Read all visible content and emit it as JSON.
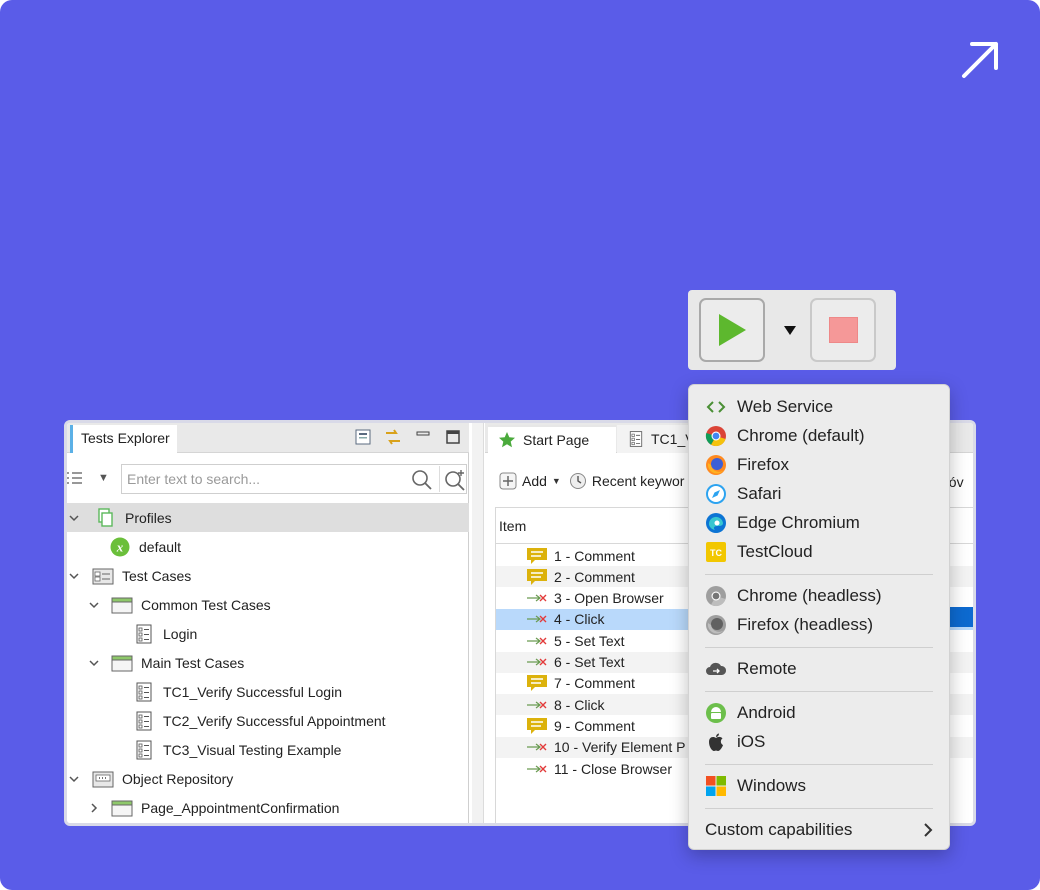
{
  "explorer": {
    "tab_title": "Tests Explorer",
    "search_placeholder": "Enter text to search...",
    "tree": {
      "profiles": "Profiles",
      "default_profile": "default",
      "test_cases": "Test Cases",
      "common_test_cases": "Common Test Cases",
      "login": "Login",
      "main_test_cases": "Main Test Cases",
      "tc1": "TC1_Verify Successful Login",
      "tc2": "TC2_Verify Successful Appointment",
      "tc3": "TC3_Visual Testing Example",
      "object_repository": "Object Repository",
      "page_appointment": "Page_AppointmentConfirmation"
    }
  },
  "editor": {
    "tabs": {
      "start_page": "Start Page",
      "tc1": "TC1_V"
    },
    "toolbar": {
      "add": "Add",
      "recent": "Recent keywor",
      "partial": "dóv"
    },
    "grid_header": "Item",
    "steps": [
      {
        "label": "1 - Comment",
        "icon": "comment-icon"
      },
      {
        "label": "2 - Comment",
        "icon": "comment-icon"
      },
      {
        "label": "3 - Open Browser",
        "icon": "keyword-icon"
      },
      {
        "label": "4 - Click",
        "icon": "keyword-icon"
      },
      {
        "label": "5 - Set Text",
        "icon": "keyword-icon"
      },
      {
        "label": "6 - Set Text",
        "icon": "keyword-icon"
      },
      {
        "label": "7 - Comment",
        "icon": "comment-icon"
      },
      {
        "label": "8 - Click",
        "icon": "keyword-icon"
      },
      {
        "label": "9 - Comment",
        "icon": "comment-icon"
      },
      {
        "label": "10 - Verify Element P",
        "icon": "keyword-icon"
      },
      {
        "label": "11 - Close Browser",
        "icon": "keyword-icon"
      }
    ],
    "selected_step": 3
  },
  "run_menu": {
    "items": {
      "web_service": "Web Service",
      "chrome": "Chrome (default)",
      "firefox": "Firefox",
      "safari": "Safari",
      "edge": "Edge Chromium",
      "testcloud": "TestCloud",
      "chrome_headless": "Chrome (headless)",
      "firefox_headless": "Firefox (headless)",
      "remote": "Remote",
      "android": "Android",
      "ios": "iOS",
      "windows": "Windows",
      "custom": "Custom capabilities"
    }
  },
  "colors": {
    "background": "#5a5ce8",
    "run_green": "#5db82e",
    "stop_red": "#f59898",
    "selection_blue": "#b9d9fb"
  }
}
